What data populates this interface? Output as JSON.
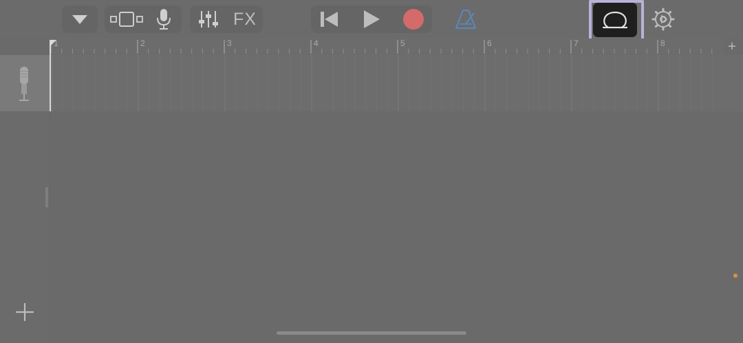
{
  "toolbar": {
    "view_menu_icon": "triangle-down-icon",
    "tracks_view_icon": "tracks-view-icon",
    "mic_icon": "microphone-icon",
    "mixer_icon": "sliders-icon",
    "fx_label": "FX",
    "rewind_icon": "skip-back-icon",
    "play_icon": "play-icon",
    "record_icon": "record-icon",
    "record_color": "#d46a6a",
    "metronome_icon": "metronome-icon",
    "metronome_color": "#5b86b8",
    "loop_icon": "loop-icon",
    "settings_icon": "gear-icon"
  },
  "ruler": {
    "bars": [
      "1",
      "2",
      "3",
      "4",
      "5",
      "6",
      "7",
      "8"
    ],
    "add_section_label": "+"
  },
  "track": {
    "instrument_icon": "microphone-icon"
  },
  "sidebar": {
    "add_track_icon": "plus-icon"
  },
  "colors": {
    "background": "#6a6a6a",
    "loop_button": "#1f1f1f",
    "highlight": "#b9b2d8"
  }
}
